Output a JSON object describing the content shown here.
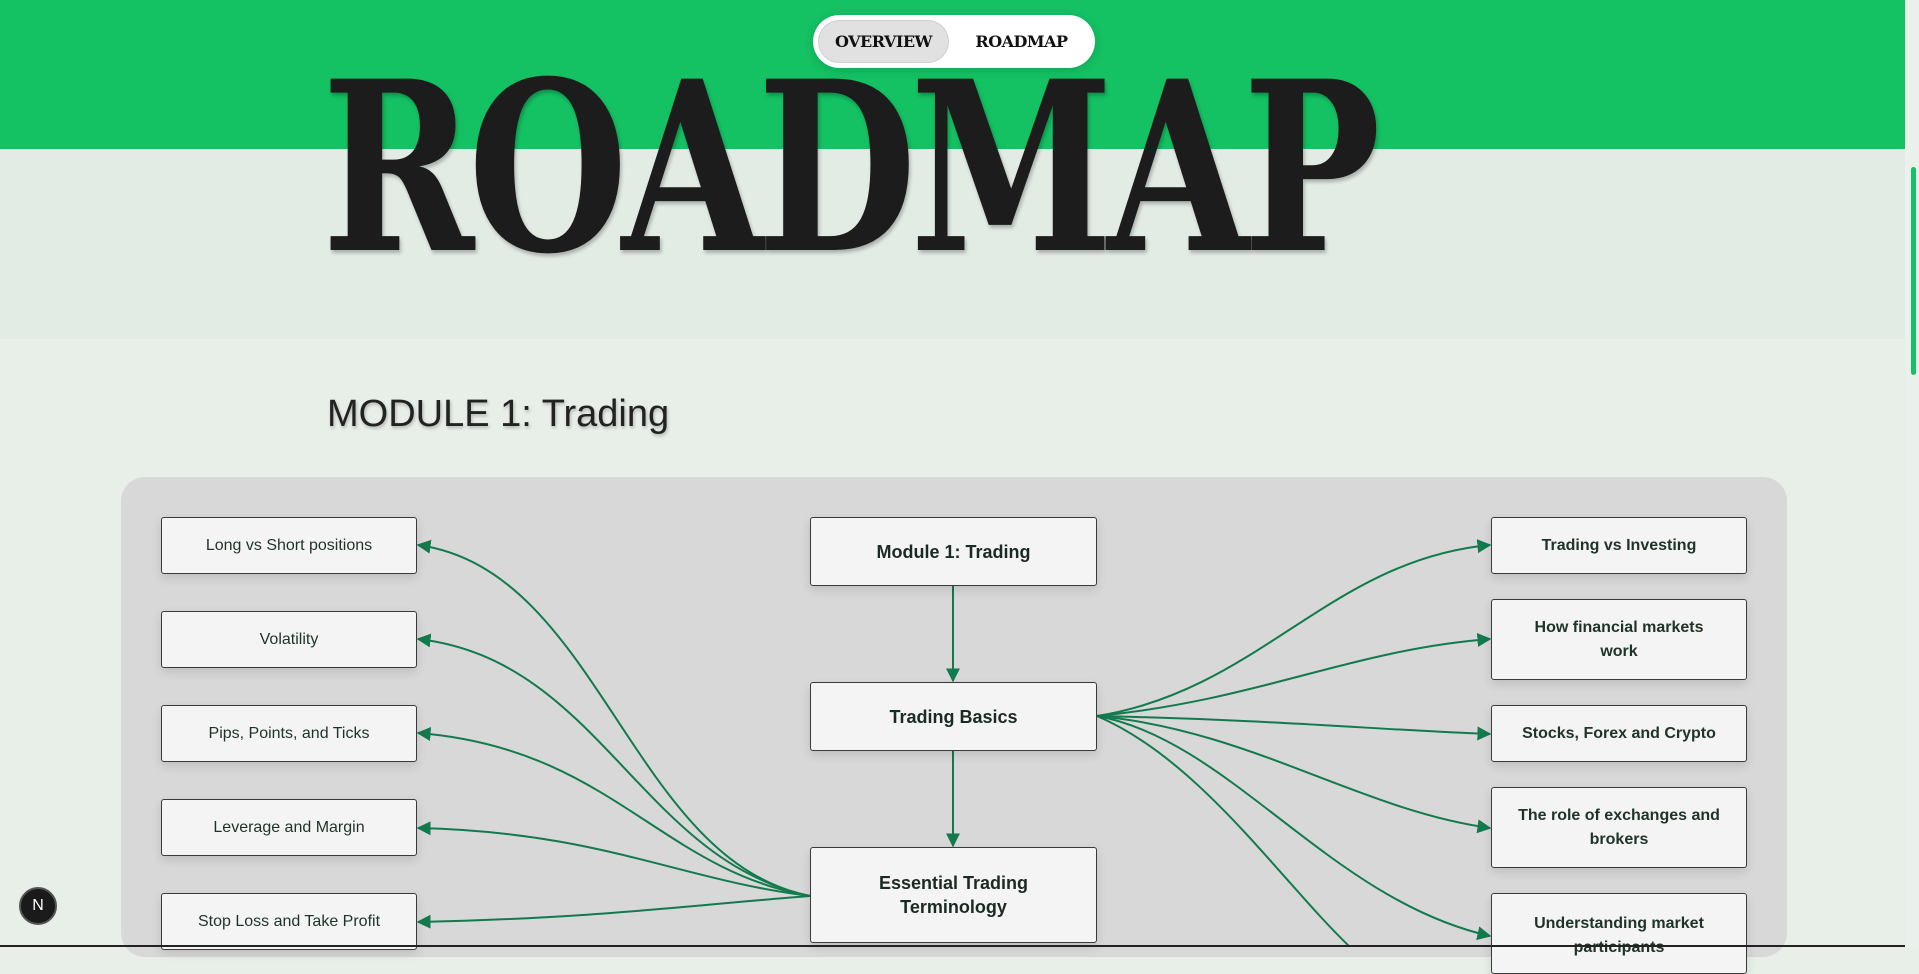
{
  "nav": {
    "items": [
      {
        "label": "OVERVIEW",
        "active": true
      },
      {
        "label": "ROADMAP",
        "active": false
      }
    ]
  },
  "hero": {
    "title": "ROADMAP"
  },
  "module": {
    "title": "MODULE 1: Trading"
  },
  "roadmap": {
    "center": [
      {
        "label": "Module 1: Trading"
      },
      {
        "label": "Trading Basics"
      },
      {
        "label": "Essential Trading Terminology"
      }
    ],
    "left": [
      {
        "label": "Long vs Short positions"
      },
      {
        "label": "Volatility"
      },
      {
        "label": "Pips, Points, and Ticks"
      },
      {
        "label": "Leverage and Margin"
      },
      {
        "label": "Stop Loss and Take Profit"
      }
    ],
    "right": [
      {
        "label": "Trading vs Investing"
      },
      {
        "label": "How financial markets work"
      },
      {
        "label": "Stocks, Forex and Crypto"
      },
      {
        "label": "The role of exchanges and brokers"
      },
      {
        "label": "Understanding market participants"
      }
    ]
  },
  "badge": {
    "label": "N"
  },
  "colors": {
    "brand_green": "#14c163",
    "edge_green": "#137a4d",
    "page_bg": "#e8efe9",
    "panel_bg": "#d8d8d8"
  }
}
